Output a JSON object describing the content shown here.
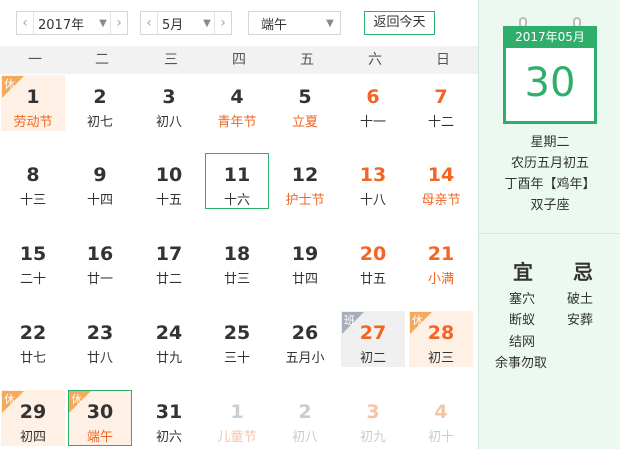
{
  "toolbar": {
    "year": "2017年",
    "month": "5月",
    "festival": "端午",
    "today_button": "返回今天",
    "prev_arrow": "‹",
    "next_arrow": "›",
    "caret": "▼"
  },
  "weekdays": [
    "一",
    "二",
    "三",
    "四",
    "五",
    "六",
    "日"
  ],
  "weeks": [
    [
      {
        "num": "1",
        "lunar": "劳动节",
        "fest": true,
        "badge": "休",
        "type": "holiday"
      },
      {
        "num": "2",
        "lunar": "初七"
      },
      {
        "num": "3",
        "lunar": "初八"
      },
      {
        "num": "4",
        "lunar": "青年节",
        "fest": true
      },
      {
        "num": "5",
        "lunar": "立夏",
        "fest": true
      },
      {
        "num": "6",
        "lunar": "十一",
        "weekend": true
      },
      {
        "num": "7",
        "lunar": "十二",
        "weekend": true
      }
    ],
    [
      {
        "num": "8",
        "lunar": "十三"
      },
      {
        "num": "9",
        "lunar": "十四"
      },
      {
        "num": "10",
        "lunar": "十五"
      },
      {
        "num": "11",
        "lunar": "十六",
        "selected": true
      },
      {
        "num": "12",
        "lunar": "护士节",
        "fest": true
      },
      {
        "num": "13",
        "lunar": "十八",
        "weekend": true
      },
      {
        "num": "14",
        "lunar": "母亲节",
        "fest": true,
        "weekend": true
      }
    ],
    [
      {
        "num": "15",
        "lunar": "二十"
      },
      {
        "num": "16",
        "lunar": "廿一"
      },
      {
        "num": "17",
        "lunar": "廿二"
      },
      {
        "num": "18",
        "lunar": "廿三"
      },
      {
        "num": "19",
        "lunar": "廿四"
      },
      {
        "num": "20",
        "lunar": "廿五",
        "weekend": true
      },
      {
        "num": "21",
        "lunar": "小满",
        "fest": true,
        "weekend": true
      }
    ],
    [
      {
        "num": "22",
        "lunar": "廿七"
      },
      {
        "num": "23",
        "lunar": "廿八"
      },
      {
        "num": "24",
        "lunar": "廿九"
      },
      {
        "num": "25",
        "lunar": "三十"
      },
      {
        "num": "26",
        "lunar": "五月小"
      },
      {
        "num": "27",
        "lunar": "初二",
        "weekend": true,
        "badge": "班",
        "type": "workday"
      },
      {
        "num": "28",
        "lunar": "初三",
        "weekend": true,
        "badge": "休",
        "type": "holiday"
      }
    ],
    [
      {
        "num": "29",
        "lunar": "初四",
        "badge": "休",
        "type": "holiday"
      },
      {
        "num": "30",
        "lunar": "端午",
        "fest": true,
        "badge": "休",
        "type": "holiday",
        "today": true
      },
      {
        "num": "31",
        "lunar": "初六"
      },
      {
        "num": "1",
        "lunar": "儿童节",
        "fest": true,
        "other": true
      },
      {
        "num": "2",
        "lunar": "初八",
        "other": true
      },
      {
        "num": "3",
        "lunar": "初九",
        "other": true,
        "weekend": true
      },
      {
        "num": "4",
        "lunar": "初十",
        "other": true,
        "weekend": true
      }
    ]
  ],
  "side": {
    "card_header": "2017年05月",
    "day": "30",
    "weekday": "星期二",
    "lunar_date": "农历五月初五",
    "ganzhi": "丁酉年【鸡年】",
    "zodiac_sign": "双子座",
    "yi_title": "宜",
    "ji_title": "忌",
    "yi": [
      "塞穴",
      "断蚁",
      "结网",
      "余事勿取"
    ],
    "ji": [
      "破土",
      "安葬"
    ]
  },
  "colors": {
    "accent": "#2fae6b",
    "festival": "#f26522",
    "holiday_bg": "#fff0e5",
    "workday_bg": "#f0f0f0",
    "side_bg": "#ecf9f1"
  }
}
